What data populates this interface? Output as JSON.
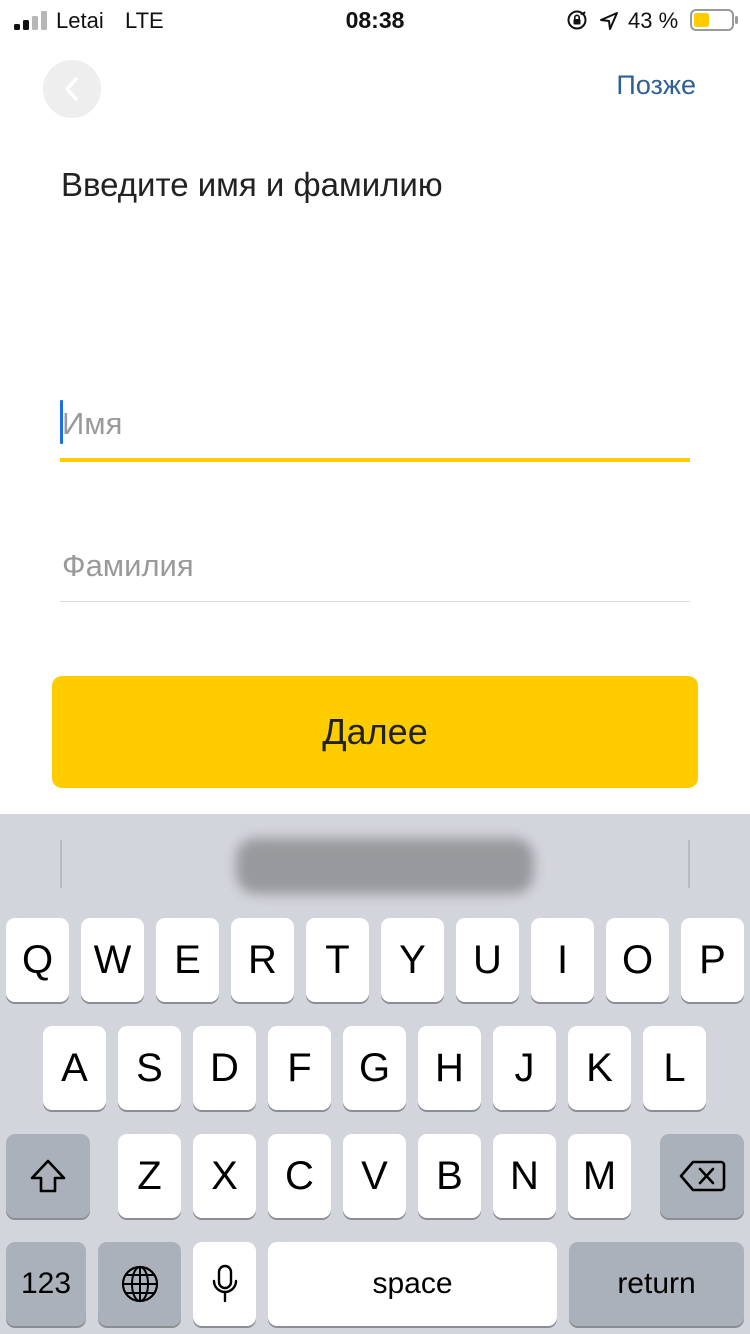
{
  "status": {
    "carrier": "Letai",
    "network": "LTE",
    "time": "08:38",
    "battery": "43 %",
    "icons": [
      "signal-icon",
      "orientation-lock-icon",
      "location-arrow-icon",
      "battery-icon"
    ],
    "battery_color": "#ffcc00"
  },
  "header": {
    "back_icon": "chevron-left-icon",
    "later_label": "Позже"
  },
  "title": "Введите имя и фамилию",
  "form": {
    "first_name": {
      "value": "",
      "placeholder": "Имя"
    },
    "last_name": {
      "value": "",
      "placeholder": "Фамилия"
    },
    "next_label": "Далее"
  },
  "colors": {
    "accent": "#ffcc00",
    "link": "#2f5f9a",
    "cursor": "#1a6fe0"
  },
  "keyboard": {
    "row1": [
      "Q",
      "W",
      "E",
      "R",
      "T",
      "Y",
      "U",
      "I",
      "O",
      "P"
    ],
    "row2": [
      "A",
      "S",
      "D",
      "F",
      "G",
      "H",
      "J",
      "K",
      "L"
    ],
    "row3": [
      "Z",
      "X",
      "C",
      "V",
      "B",
      "N",
      "M"
    ],
    "numbers_label": "123",
    "space_label": "space",
    "return_label": "return",
    "icons": [
      "shift-icon",
      "backspace-icon",
      "globe-icon",
      "microphone-icon"
    ]
  }
}
